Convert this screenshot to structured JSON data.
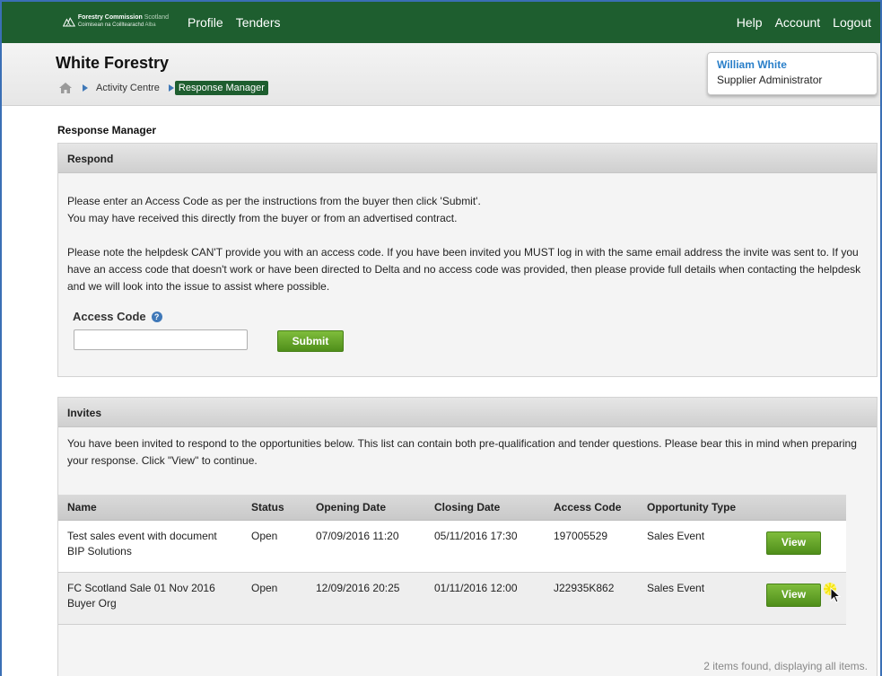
{
  "nav": {
    "logo_line1": "Forestry Commission",
    "logo_line1_light": "Scotland",
    "logo_line2": "Coimisean na Coilltearachd",
    "logo_line2_light": "Alba",
    "left": [
      "Profile",
      "Tenders"
    ],
    "right": [
      "Help",
      "Account",
      "Logout"
    ]
  },
  "header": {
    "org_title": "White Forestry",
    "breadcrumb": [
      "Activity Centre",
      "Response Manager"
    ]
  },
  "user": {
    "name": "William White",
    "role": "Supplier Administrator"
  },
  "page_title": "Response Manager",
  "respond": {
    "heading": "Respond",
    "para1_line1": "Please enter an Access Code as per the instructions from the buyer then click 'Submit'.",
    "para1_line2": "You may have received this directly from the buyer or from an advertised contract.",
    "para2": "Please note the helpdesk CAN'T provide you with an access code. If you have been invited you MUST log in with the same email address the invite was sent to. If you have an access code that doesn't work or have been directed to Delta and no access code was provided, then please provide full details when contacting the helpdesk and we will look into the issue to assist where possible.",
    "access_label": "Access Code",
    "access_value": "",
    "submit_label": "Submit"
  },
  "invites": {
    "heading": "Invites",
    "intro": "You have been invited to respond to the opportunities below. This list can contain both pre-qualification and tender questions. Please bear this in mind when preparing your response. Click \"View\" to continue.",
    "columns": [
      "Name",
      "Status",
      "Opening Date",
      "Closing Date",
      "Access Code",
      "Opportunity Type"
    ],
    "rows": [
      {
        "name_line1": "Test sales event with document",
        "name_line2": "BIP Solutions",
        "status": "Open",
        "opening": "07/09/2016 11:20",
        "closing": "05/11/2016 17:30",
        "code": "197005529",
        "type": "Sales Event",
        "action": "View"
      },
      {
        "name_line1": "FC Scotland Sale 01 Nov 2016",
        "name_line2": "Buyer Org",
        "status": "Open",
        "opening": "12/09/2016 20:25",
        "closing": "01/11/2016 12:00",
        "code": "J22935K862",
        "type": "Sales Event",
        "action": "View"
      }
    ],
    "footer": "2 items found, displaying all items."
  },
  "colors": {
    "nav_green": "#1e5e2f",
    "button_green": "#5e9e24",
    "link_blue": "#2a7fc9"
  }
}
